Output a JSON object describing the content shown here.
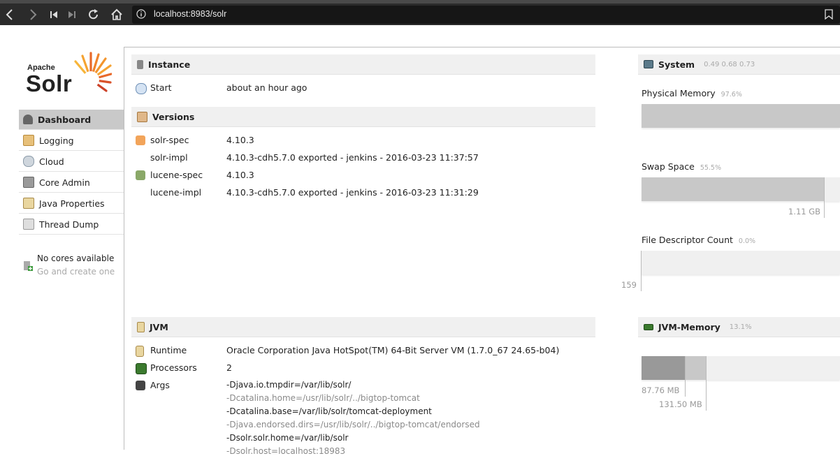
{
  "browser": {
    "url": "localhost:8983/solr",
    "icons": [
      "back-icon",
      "forward-icon",
      "first-icon",
      "last-icon",
      "reload-icon",
      "home-icon",
      "info-icon",
      "bookmark-icon"
    ]
  },
  "logo": {
    "apache": "Apache",
    "solr": "Solr"
  },
  "sidebar": {
    "items": [
      {
        "label": "Dashboard",
        "icon": "dashboard-icon",
        "active": true
      },
      {
        "label": "Logging",
        "icon": "logging-icon"
      },
      {
        "label": "Cloud",
        "icon": "cloud-icon"
      },
      {
        "label": "Core Admin",
        "icon": "core-admin-icon"
      },
      {
        "label": "Java Properties",
        "icon": "java-properties-icon"
      },
      {
        "label": "Thread Dump",
        "icon": "thread-dump-icon"
      }
    ],
    "no_cores": "No cores available",
    "no_cores_sub": "Go and create one"
  },
  "instance": {
    "title": "Instance",
    "start_label": "Start",
    "start_value": "about an hour ago"
  },
  "versions": {
    "title": "Versions",
    "rows": [
      {
        "label": "solr-spec",
        "value": "4.10.3"
      },
      {
        "label": "solr-impl",
        "value": "4.10.3-cdh5.7.0 exported - jenkins - 2016-03-23 11:37:57"
      },
      {
        "label": "lucene-spec",
        "value": "4.10.3"
      },
      {
        "label": "lucene-impl",
        "value": "4.10.3-cdh5.7.0 exported - jenkins - 2016-03-23 11:31:29"
      }
    ]
  },
  "jvm": {
    "title": "JVM",
    "runtime_label": "Runtime",
    "runtime_value": "Oracle Corporation Java HotSpot(TM) 64-Bit Server VM (1.7.0_67 24.65-b04)",
    "processors_label": "Processors",
    "processors_value": "2",
    "args_label": "Args",
    "args": [
      "-Djava.io.tmpdir=/var/lib/solr/",
      "-Dcatalina.home=/usr/lib/solr/../bigtop-tomcat",
      "-Dcatalina.base=/var/lib/solr/tomcat-deployment",
      "-Djava.endorsed.dirs=/usr/lib/solr/../bigtop-tomcat/endorsed",
      "-Dsolr.solr.home=/var/lib/solr",
      "-Dsolr.host=localhost:18983"
    ]
  },
  "system": {
    "title": "System",
    "load": "0.49  0.68  0.73",
    "physical_memory_label": "Physical Memory",
    "physical_memory_pct": "97.6%",
    "physical_memory_fraction": 0.976,
    "swap_label": "Swap Space",
    "swap_pct": "55.5%",
    "swap_fraction": 0.555,
    "swap_used": "1.11 GB",
    "fd_label": "File Descriptor Count",
    "fd_pct": "0.0%",
    "fd_value": "159"
  },
  "jvm_memory": {
    "title": "JVM-Memory",
    "pct": "13.1%",
    "used": "87.76 MB",
    "committed": "131.50 MB"
  },
  "colors": {
    "active_bg": "#c9c9c9",
    "panel_head": "#f0f0f0",
    "bar": "#c8c8c8",
    "jvm_used": "#999999",
    "jvm_committed": "#c8c8c8"
  }
}
